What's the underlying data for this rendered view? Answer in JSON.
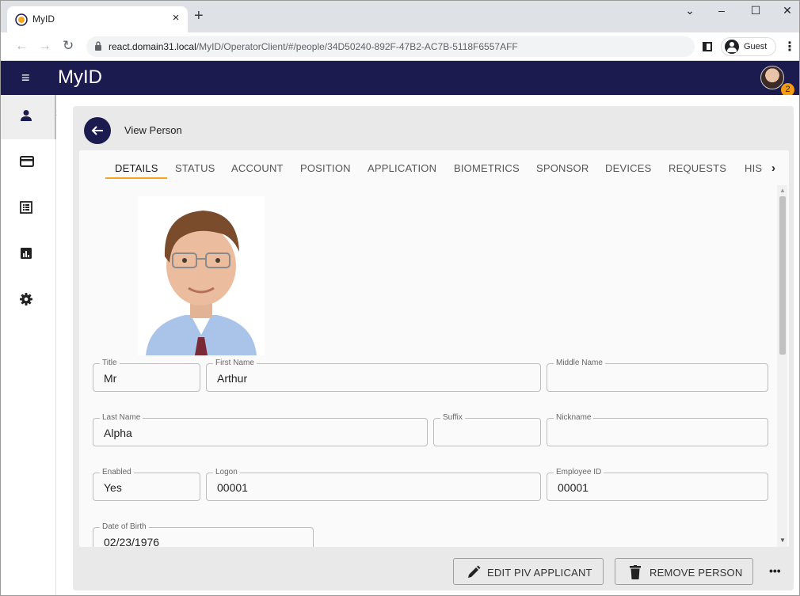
{
  "browser": {
    "tab_title": "MyID",
    "tab_close": "×",
    "new_tab": "+",
    "url_host": "react.domain31.local",
    "url_path": "/MyID/OperatorClient/#/people/34D50240-892F-47B2-AC7B-5118F6557AFF",
    "profile_label": "Guest",
    "window_controls": [
      "⌄",
      "–",
      "☐",
      "✕"
    ]
  },
  "appbar": {
    "title": "MyID",
    "notification_count": "2"
  },
  "leftnav": {
    "items": [
      "person-icon",
      "card-icon",
      "list-icon",
      "chart-icon",
      "gear-icon"
    ],
    "active": "person-icon"
  },
  "page": {
    "title": "View Person"
  },
  "tabs": {
    "items": [
      "DETAILS",
      "STATUS",
      "ACCOUNT",
      "POSITION",
      "APPLICATION",
      "BIOMETRICS",
      "SPONSOR",
      "DEVICES",
      "REQUESTS",
      "HIS"
    ],
    "active": "DETAILS"
  },
  "fields": {
    "title": {
      "label": "Title",
      "value": "Mr"
    },
    "first_name": {
      "label": "First Name",
      "value": "Arthur"
    },
    "middle_name": {
      "label": "Middle Name",
      "value": ""
    },
    "last_name": {
      "label": "Last Name",
      "value": "Alpha"
    },
    "suffix": {
      "label": "Suffix",
      "value": ""
    },
    "nickname": {
      "label": "Nickname",
      "value": ""
    },
    "enabled": {
      "label": "Enabled",
      "value": "Yes"
    },
    "logon": {
      "label": "Logon",
      "value": "00001"
    },
    "employee_id": {
      "label": "Employee ID",
      "value": "00001"
    },
    "date_of_birth": {
      "label": "Date of Birth",
      "value": "02/23/1976"
    }
  },
  "actions": {
    "edit_label": "EDIT PIV APPLICANT",
    "remove_label": "REMOVE PERSON",
    "more": "•••"
  },
  "colors": {
    "appbar": "#1b1b4f",
    "accent": "#f5a623"
  }
}
